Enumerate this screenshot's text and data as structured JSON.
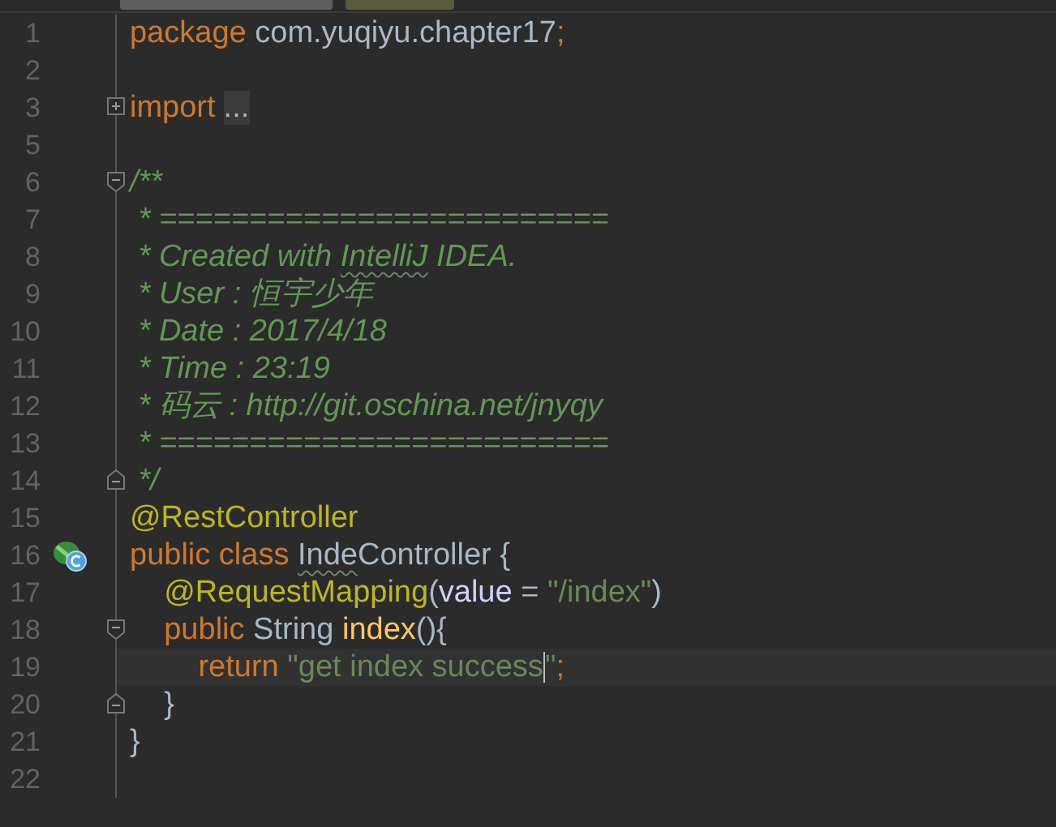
{
  "tabs": [
    {
      "selected": false
    },
    {
      "selected": true
    }
  ],
  "lines": [
    {
      "number": "1",
      "tokens": [
        {
          "kind": "keyword",
          "text": "package"
        },
        {
          "kind": "plain",
          "text": " com.yuqiyu.chapter17"
        },
        {
          "kind": "keyword",
          "text": ";"
        }
      ]
    },
    {
      "number": "2"
    },
    {
      "number": "3",
      "fold": {
        "kind": "expand"
      },
      "tokens": [
        {
          "kind": "keyword",
          "text": "import"
        },
        {
          "kind": "folded",
          "text": "..."
        }
      ]
    },
    {
      "number": "5"
    },
    {
      "number": "6",
      "fold": {
        "kind": "start"
      },
      "tokens": [
        {
          "kind": "comment",
          "text": "/**"
        }
      ]
    },
    {
      "number": "7",
      "tokens": [
        {
          "kind": "comment",
          "text": " * ========================="
        }
      ]
    },
    {
      "number": "8",
      "tokens": [
        {
          "kind": "comment",
          "text": " * Created with "
        },
        {
          "kind": "comment",
          "text": "IntelliJ",
          "typo": true
        },
        {
          "kind": "comment",
          "text": " IDEA."
        }
      ]
    },
    {
      "number": "9",
      "tokens": [
        {
          "kind": "comment",
          "text": " * User : 恒宇少年"
        }
      ]
    },
    {
      "number": "10",
      "tokens": [
        {
          "kind": "comment",
          "text": " * Date : 2017/4/18"
        }
      ]
    },
    {
      "number": "11",
      "tokens": [
        {
          "kind": "comment",
          "text": " * Time : 23:19"
        }
      ]
    },
    {
      "number": "12",
      "tokens": [
        {
          "kind": "comment",
          "text": " * 码云 : http://git.oschina.net/jnyqy"
        }
      ]
    },
    {
      "number": "13",
      "tokens": [
        {
          "kind": "comment",
          "text": " * ========================="
        }
      ]
    },
    {
      "number": "14",
      "fold": {
        "kind": "end"
      },
      "tokens": [
        {
          "kind": "comment",
          "text": " */"
        }
      ]
    },
    {
      "number": "15",
      "tokens": [
        {
          "kind": "annotation",
          "text": "@RestController"
        }
      ]
    },
    {
      "number": "16",
      "gutter_icon": {
        "kind": "class"
      },
      "tokens": [
        {
          "kind": "keyword",
          "text": "public class "
        },
        {
          "kind": "plain",
          "text": "Inde",
          "typo": true
        },
        {
          "kind": "plain",
          "text": "Controller {"
        }
      ]
    },
    {
      "number": "17",
      "tokens": [
        {
          "kind": "annotation",
          "text": "    @RequestMapping"
        },
        {
          "kind": "plain",
          "text": "("
        },
        {
          "kind": "param",
          "text": "value"
        },
        {
          "kind": "plain",
          "text": " = "
        },
        {
          "kind": "string",
          "text": "\"/index\""
        },
        {
          "kind": "plain",
          "text": ")"
        }
      ]
    },
    {
      "number": "18",
      "fold": {
        "kind": "start"
      },
      "tokens": [
        {
          "kind": "keyword",
          "text": "    public "
        },
        {
          "kind": "plain",
          "text": "String "
        },
        {
          "kind": "method",
          "text": "index"
        },
        {
          "kind": "plain",
          "text": "(){"
        }
      ]
    },
    {
      "number": "19",
      "current": true,
      "tokens": [
        {
          "kind": "keyword",
          "text": "        return "
        },
        {
          "kind": "string",
          "text": "\"get index success",
          "caret": true
        },
        {
          "kind": "string",
          "text": "\""
        },
        {
          "kind": "keyword",
          "text": ";"
        }
      ]
    },
    {
      "number": "20",
      "fold": {
        "kind": "end"
      },
      "tokens": [
        {
          "kind": "plain",
          "text": "    }"
        }
      ]
    },
    {
      "number": "21",
      "tokens": [
        {
          "kind": "plain",
          "text": "}"
        }
      ]
    },
    {
      "number": "22"
    }
  ]
}
